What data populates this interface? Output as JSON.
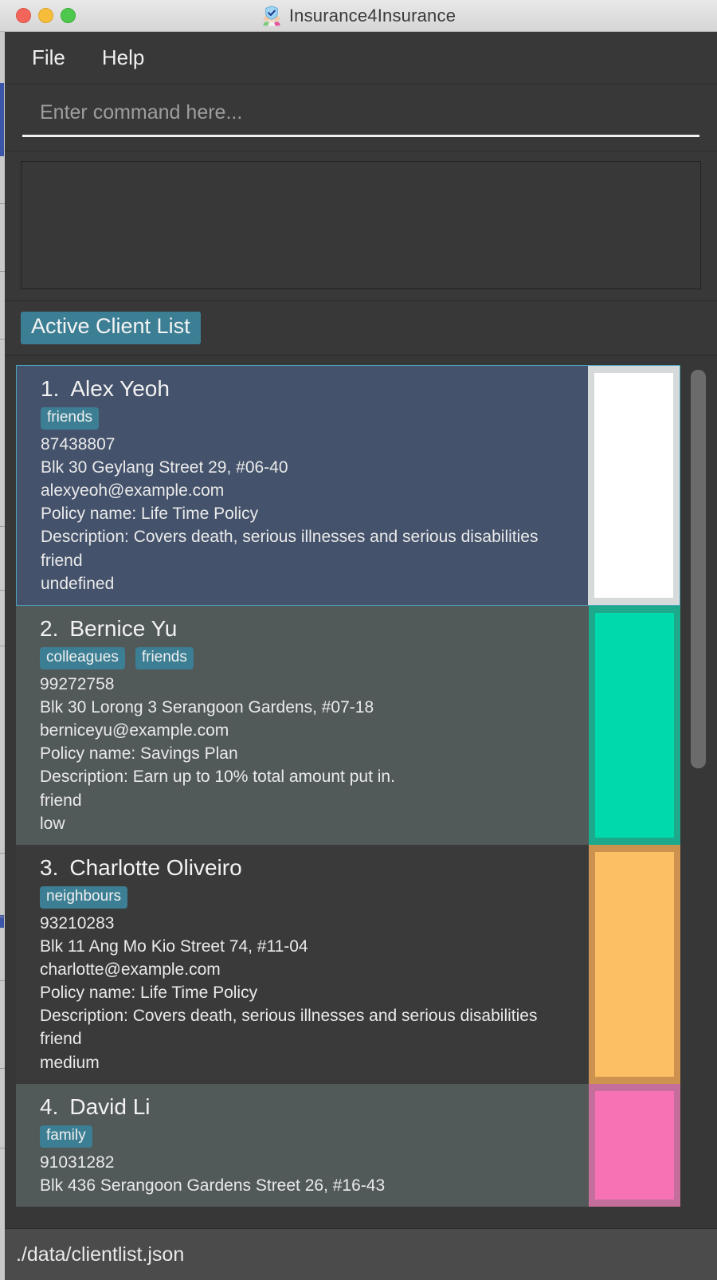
{
  "window": {
    "title": "Insurance4Insurance",
    "app_icon": "people-shield-icon",
    "traffic_lights": {
      "close": "close-window-button",
      "minimize": "minimize-window-button",
      "zoom": "zoom-window-button"
    }
  },
  "menubar": {
    "items": [
      {
        "label": "File"
      },
      {
        "label": "Help"
      }
    ]
  },
  "command": {
    "value": "",
    "placeholder": "Enter command here..."
  },
  "result": {
    "text": ""
  },
  "list": {
    "header": "Active Client List",
    "clients": [
      {
        "index": "1.",
        "name": "Alex Yeoh",
        "tags": [
          "friends"
        ],
        "phone": "87438807",
        "address": "Blk 30 Geylang Street 29, #06-40",
        "email": "alexyeoh@example.com",
        "policy": "Policy name: Life Time Policy",
        "description": "Description: Covers death, serious illnesses and serious disabilities",
        "relationship": "friend",
        "priority": "undefined",
        "swatch_color": "#ffffff",
        "swatch_border": "#d6dadb",
        "selected": true
      },
      {
        "index": "2.",
        "name": "Bernice Yu",
        "tags": [
          "colleagues",
          "friends"
        ],
        "phone": "99272758",
        "address": "Blk 30 Lorong 3 Serangoon Gardens, #07-18",
        "email": "berniceyu@example.com",
        "policy": "Policy name: Savings Plan",
        "description": "Description: Earn up to 10% total amount put in.",
        "relationship": "friend",
        "priority": "low",
        "swatch_color": "#00d9ab",
        "swatch_border": "#1fa98c",
        "selected": false
      },
      {
        "index": "3.",
        "name": "Charlotte Oliveiro",
        "tags": [
          "neighbours"
        ],
        "phone": "93210283",
        "address": "Blk 11 Ang Mo Kio Street 74, #11-04",
        "email": "charlotte@example.com",
        "policy": "Policy name: Life Time Policy",
        "description": "Description: Covers death, serious illnesses and serious disabilities",
        "relationship": "friend",
        "priority": "medium",
        "swatch_color": "#fcbf63",
        "swatch_border": "#cd9150",
        "selected": false
      },
      {
        "index": "4.",
        "name": "David Li",
        "tags": [
          "family"
        ],
        "phone": "91031282",
        "address": "Blk 436 Serangoon Gardens Street 26, #16-43",
        "email": "",
        "policy": "",
        "description": "",
        "relationship": "",
        "priority": "",
        "swatch_color": "#f771b5",
        "swatch_border": "#c46e9b",
        "selected": false
      }
    ]
  },
  "statusbar": {
    "path": "./data/clientlist.json"
  },
  "colors": {
    "accent_teal": "#3c7e93",
    "selected_card": "#44526b",
    "selected_border": "#4aa6bd",
    "window_bg": "#373737",
    "statusbar_bg": "#4b4b4b"
  }
}
